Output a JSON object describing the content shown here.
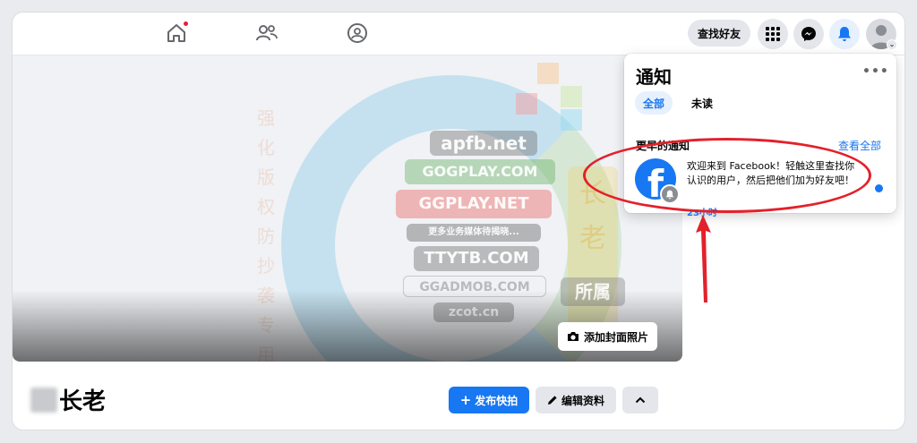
{
  "topnav": {
    "icons": [
      "home-icon",
      "friends-icon",
      "groups-icon"
    ],
    "find_friends_label": "查找好友",
    "right_icons": [
      "menu-grid-icon",
      "messenger-icon",
      "bell-icon",
      "account-avatar"
    ]
  },
  "cover": {
    "add_cover_label": "添加封面照片"
  },
  "profile": {
    "name": "长老",
    "post_button": "发布快拍",
    "edit_button": "编辑资料"
  },
  "notifications": {
    "title": "通知",
    "tabs": [
      {
        "label": "全部",
        "active": true
      },
      {
        "label": "未读",
        "active": false
      }
    ],
    "section_title": "更早的通知",
    "see_all": "查看全部",
    "items": [
      {
        "text": "欢迎来到 Facebook！轻触这里查找你认识的用户，然后把他们加为好友吧！",
        "time": "23小时",
        "unread": true,
        "avatar_letter": "f"
      }
    ]
  },
  "watermark": {
    "lines": [
      "apfb.net",
      "GOGPLAY.COM",
      "GGPLAY.NET",
      "更多业务媒体待揭晓...",
      "TTYTB.COM",
      "GGADMOB.COM",
      "zcot.cn"
    ],
    "vertical_text_left": "强化版权防抄袭专用",
    "vertical_text_right": "长老",
    "owner_tag": "所属"
  },
  "colors": {
    "accent": "#1877f2",
    "annotation": "#e3212b",
    "notification_dot": "#e41e3f"
  }
}
